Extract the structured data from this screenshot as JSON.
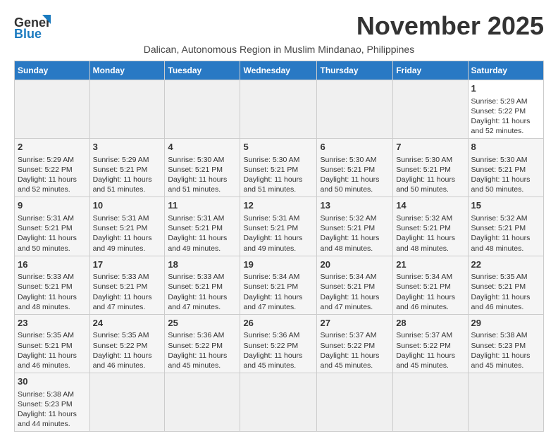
{
  "header": {
    "logo_general": "General",
    "logo_blue": "Blue",
    "month_title": "November 2025",
    "subtitle": "Dalican, Autonomous Region in Muslim Mindanao, Philippines"
  },
  "weekdays": [
    "Sunday",
    "Monday",
    "Tuesday",
    "Wednesday",
    "Thursday",
    "Friday",
    "Saturday"
  ],
  "weeks": [
    [
      {
        "day": "",
        "lines": []
      },
      {
        "day": "",
        "lines": []
      },
      {
        "day": "",
        "lines": []
      },
      {
        "day": "",
        "lines": []
      },
      {
        "day": "",
        "lines": []
      },
      {
        "day": "",
        "lines": []
      },
      {
        "day": "1",
        "lines": [
          "Sunrise: 5:29 AM",
          "Sunset: 5:22 PM",
          "Daylight: 11 hours",
          "and 52 minutes."
        ]
      }
    ],
    [
      {
        "day": "2",
        "lines": [
          "Sunrise: 5:29 AM",
          "Sunset: 5:22 PM",
          "Daylight: 11 hours",
          "and 52 minutes."
        ]
      },
      {
        "day": "3",
        "lines": [
          "Sunrise: 5:29 AM",
          "Sunset: 5:21 PM",
          "Daylight: 11 hours",
          "and 51 minutes."
        ]
      },
      {
        "day": "4",
        "lines": [
          "Sunrise: 5:30 AM",
          "Sunset: 5:21 PM",
          "Daylight: 11 hours",
          "and 51 minutes."
        ]
      },
      {
        "day": "5",
        "lines": [
          "Sunrise: 5:30 AM",
          "Sunset: 5:21 PM",
          "Daylight: 11 hours",
          "and 51 minutes."
        ]
      },
      {
        "day": "6",
        "lines": [
          "Sunrise: 5:30 AM",
          "Sunset: 5:21 PM",
          "Daylight: 11 hours",
          "and 50 minutes."
        ]
      },
      {
        "day": "7",
        "lines": [
          "Sunrise: 5:30 AM",
          "Sunset: 5:21 PM",
          "Daylight: 11 hours",
          "and 50 minutes."
        ]
      },
      {
        "day": "8",
        "lines": [
          "Sunrise: 5:30 AM",
          "Sunset: 5:21 PM",
          "Daylight: 11 hours",
          "and 50 minutes."
        ]
      }
    ],
    [
      {
        "day": "9",
        "lines": [
          "Sunrise: 5:31 AM",
          "Sunset: 5:21 PM",
          "Daylight: 11 hours",
          "and 50 minutes."
        ]
      },
      {
        "day": "10",
        "lines": [
          "Sunrise: 5:31 AM",
          "Sunset: 5:21 PM",
          "Daylight: 11 hours",
          "and 49 minutes."
        ]
      },
      {
        "day": "11",
        "lines": [
          "Sunrise: 5:31 AM",
          "Sunset: 5:21 PM",
          "Daylight: 11 hours",
          "and 49 minutes."
        ]
      },
      {
        "day": "12",
        "lines": [
          "Sunrise: 5:31 AM",
          "Sunset: 5:21 PM",
          "Daylight: 11 hours",
          "and 49 minutes."
        ]
      },
      {
        "day": "13",
        "lines": [
          "Sunrise: 5:32 AM",
          "Sunset: 5:21 PM",
          "Daylight: 11 hours",
          "and 48 minutes."
        ]
      },
      {
        "day": "14",
        "lines": [
          "Sunrise: 5:32 AM",
          "Sunset: 5:21 PM",
          "Daylight: 11 hours",
          "and 48 minutes."
        ]
      },
      {
        "day": "15",
        "lines": [
          "Sunrise: 5:32 AM",
          "Sunset: 5:21 PM",
          "Daylight: 11 hours",
          "and 48 minutes."
        ]
      }
    ],
    [
      {
        "day": "16",
        "lines": [
          "Sunrise: 5:33 AM",
          "Sunset: 5:21 PM",
          "Daylight: 11 hours",
          "and 48 minutes."
        ]
      },
      {
        "day": "17",
        "lines": [
          "Sunrise: 5:33 AM",
          "Sunset: 5:21 PM",
          "Daylight: 11 hours",
          "and 47 minutes."
        ]
      },
      {
        "day": "18",
        "lines": [
          "Sunrise: 5:33 AM",
          "Sunset: 5:21 PM",
          "Daylight: 11 hours",
          "and 47 minutes."
        ]
      },
      {
        "day": "19",
        "lines": [
          "Sunrise: 5:34 AM",
          "Sunset: 5:21 PM",
          "Daylight: 11 hours",
          "and 47 minutes."
        ]
      },
      {
        "day": "20",
        "lines": [
          "Sunrise: 5:34 AM",
          "Sunset: 5:21 PM",
          "Daylight: 11 hours",
          "and 47 minutes."
        ]
      },
      {
        "day": "21",
        "lines": [
          "Sunrise: 5:34 AM",
          "Sunset: 5:21 PM",
          "Daylight: 11 hours",
          "and 46 minutes."
        ]
      },
      {
        "day": "22",
        "lines": [
          "Sunrise: 5:35 AM",
          "Sunset: 5:21 PM",
          "Daylight: 11 hours",
          "and 46 minutes."
        ]
      }
    ],
    [
      {
        "day": "23",
        "lines": [
          "Sunrise: 5:35 AM",
          "Sunset: 5:21 PM",
          "Daylight: 11 hours",
          "and 46 minutes."
        ]
      },
      {
        "day": "24",
        "lines": [
          "Sunrise: 5:35 AM",
          "Sunset: 5:22 PM",
          "Daylight: 11 hours",
          "and 46 minutes."
        ]
      },
      {
        "day": "25",
        "lines": [
          "Sunrise: 5:36 AM",
          "Sunset: 5:22 PM",
          "Daylight: 11 hours",
          "and 45 minutes."
        ]
      },
      {
        "day": "26",
        "lines": [
          "Sunrise: 5:36 AM",
          "Sunset: 5:22 PM",
          "Daylight: 11 hours",
          "and 45 minutes."
        ]
      },
      {
        "day": "27",
        "lines": [
          "Sunrise: 5:37 AM",
          "Sunset: 5:22 PM",
          "Daylight: 11 hours",
          "and 45 minutes."
        ]
      },
      {
        "day": "28",
        "lines": [
          "Sunrise: 5:37 AM",
          "Sunset: 5:22 PM",
          "Daylight: 11 hours",
          "and 45 minutes."
        ]
      },
      {
        "day": "29",
        "lines": [
          "Sunrise: 5:38 AM",
          "Sunset: 5:23 PM",
          "Daylight: 11 hours",
          "and 45 minutes."
        ]
      }
    ],
    [
      {
        "day": "30",
        "lines": [
          "Sunrise: 5:38 AM",
          "Sunset: 5:23 PM",
          "Daylight: 11 hours",
          "and 44 minutes."
        ]
      },
      {
        "day": "",
        "lines": []
      },
      {
        "day": "",
        "lines": []
      },
      {
        "day": "",
        "lines": []
      },
      {
        "day": "",
        "lines": []
      },
      {
        "day": "",
        "lines": []
      },
      {
        "day": "",
        "lines": []
      }
    ]
  ]
}
